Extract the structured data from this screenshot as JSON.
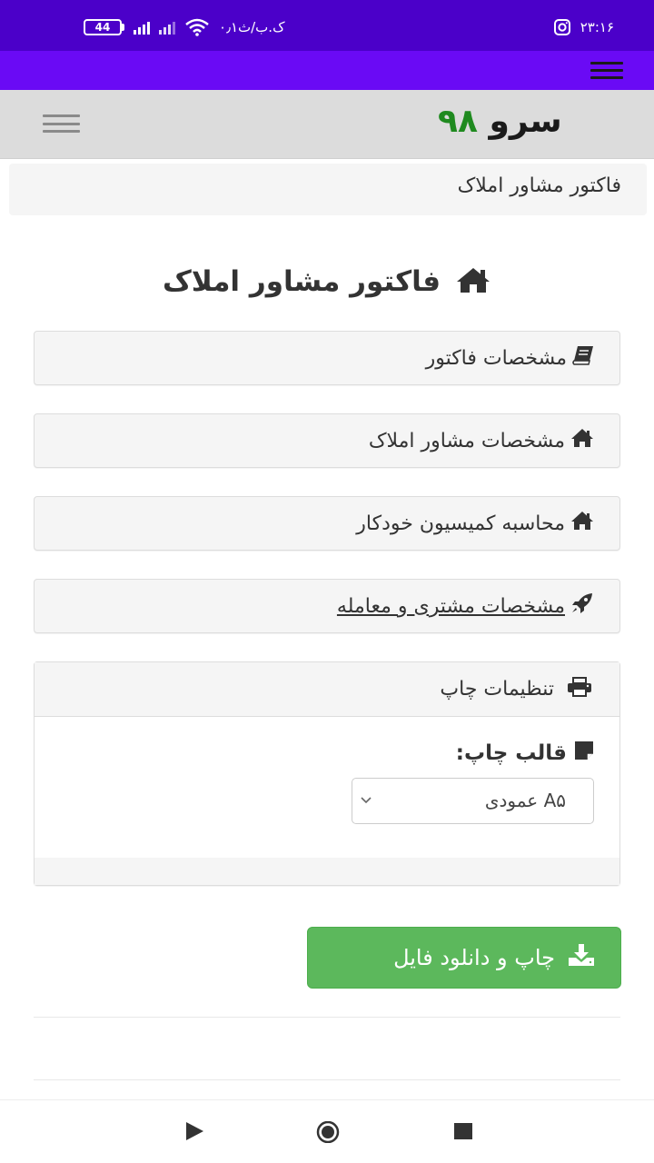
{
  "status_bar": {
    "time": "۲۳:۱۶",
    "battery": "44",
    "data_speed": "۰٫۱ک.ب/ث"
  },
  "header": {
    "logo_text": "سرو",
    "logo_number": "۹۸"
  },
  "breadcrumb": {
    "current": "فاکتور مشاور املاک"
  },
  "page": {
    "title": "فاکتور مشاور املاک"
  },
  "panels": [
    {
      "label": "مشخصات فاکتور",
      "icon": "book-icon"
    },
    {
      "label": "مشخصات مشاور املاک",
      "icon": "home-icon"
    },
    {
      "label": "محاسبه کمیسیون خودکار",
      "icon": "home-icon"
    },
    {
      "label": "مشخصات مشتری و معامله",
      "icon": "rocket-icon"
    }
  ],
  "print_settings": {
    "title": "تنظیمات چاپ",
    "template_label": "قالب چاپ:",
    "template_value": "A۵ عمودی"
  },
  "download_button": {
    "label": "چاپ و دانلود فایل"
  },
  "colors": {
    "status_bar": "#4b00c9",
    "app_bar": "#6a0af5",
    "logo_number": "#1f8a1f",
    "success_button": "#5cb85c"
  }
}
